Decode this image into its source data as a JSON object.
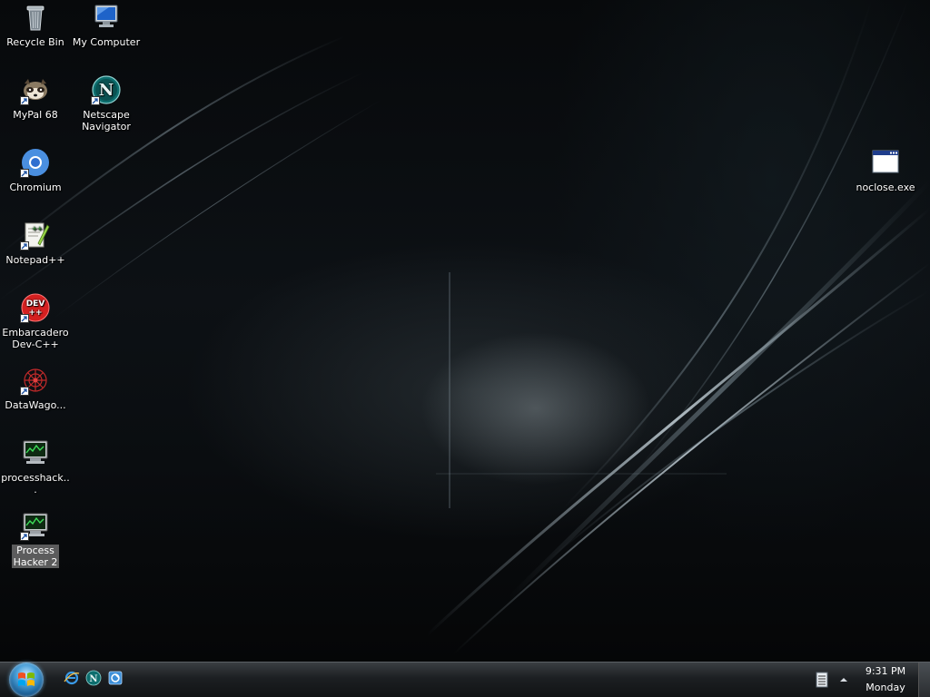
{
  "desktop": {
    "icons": [
      {
        "label": "Recycle Bin",
        "icon": "recycle-bin-icon"
      },
      {
        "label": "My Computer",
        "icon": "my-computer-icon"
      },
      {
        "label": "MyPal 68",
        "icon": "mypal-icon"
      },
      {
        "label": "Netscape\nNavigator",
        "icon": "netscape-icon"
      },
      {
        "label": "Chromium",
        "icon": "chromium-icon"
      },
      {
        "label": "Notepad++",
        "icon": "notepad-plus-plus-icon"
      },
      {
        "label": "Embarcadero\nDev-C++",
        "icon": "dev-cpp-icon"
      },
      {
        "label": "DataWago...",
        "icon": "datawagon-icon"
      },
      {
        "label": "processhack...",
        "icon": "processhacker-icon"
      },
      {
        "label": "Process\nHacker 2",
        "icon": "process-hacker-2-icon"
      },
      {
        "label": "noclose.exe",
        "icon": "exe-window-icon"
      }
    ]
  },
  "taskbar": {
    "start_button": "start-orb-icon",
    "quick_launch": [
      "internet-explorer-icon",
      "netscape-icon",
      "explorer-icon"
    ],
    "tray_icons": [
      "keyboard-icon",
      "show-hidden-icons-chevron"
    ],
    "clock": {
      "time": "9:31 PM",
      "day": "Monday"
    }
  },
  "colors": {
    "taskbar": "#1c1f22",
    "accent": "#4aa0d9",
    "text": "#ffffff"
  }
}
